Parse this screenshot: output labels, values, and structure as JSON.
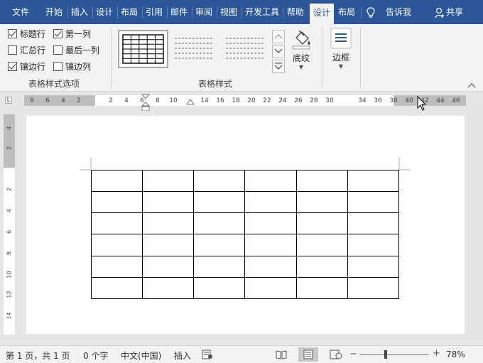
{
  "tabs": {
    "file": "文件",
    "home": "开始",
    "insert": "插入",
    "design": "设计",
    "layout": "布局",
    "references": "引用",
    "mailings": "邮件",
    "review": "审阅",
    "view": "视图",
    "developer": "开发工具",
    "help": "帮助",
    "table_design": "设计",
    "table_layout": "布局",
    "tell_me": "告诉我",
    "share": "共享"
  },
  "ribbon": {
    "options": {
      "header_row": "标题行",
      "first_column": "第一列",
      "total_row": "汇总行",
      "last_column": "最后一列",
      "banded_rows": "镶边行",
      "banded_columns": "镶边列"
    },
    "options_group_label": "表格样式选项",
    "styles_group_label": "表格样式",
    "shading_label": "底纹",
    "borders_label": "边框"
  },
  "ruler": {
    "labels": [
      "8",
      "6",
      "4",
      "2",
      "2",
      "4",
      "6",
      "8",
      "10",
      "14",
      "16",
      "18",
      "20",
      "22",
      "24",
      "26",
      "28",
      "30",
      "34",
      "36",
      "38",
      "40",
      "42",
      "44",
      "46"
    ],
    "vertical_labels": [
      "4",
      "2",
      "2",
      "4",
      "6",
      "8",
      "10",
      "12",
      "14"
    ]
  },
  "table": {
    "rows": 6,
    "columns": 6
  },
  "status": {
    "page": "第 1 页，共 1 页",
    "words": "0 个字",
    "language": "中文(中国)",
    "mode": "插入",
    "zoom": "78%"
  },
  "colors": {
    "title_bar": "#2b579a",
    "ribbon": "#f3f3f3",
    "canvas": "#e6e6e6"
  }
}
